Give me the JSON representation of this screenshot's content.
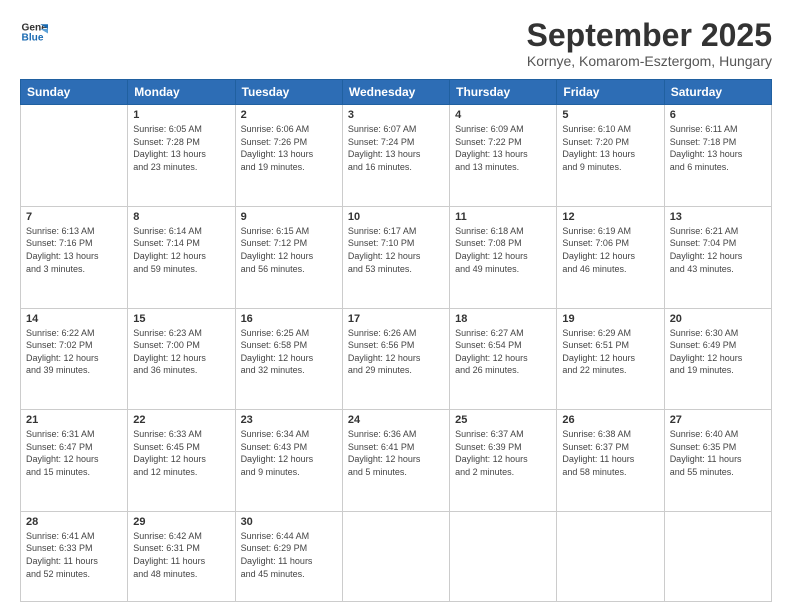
{
  "header": {
    "logo_line1": "General",
    "logo_line2": "Blue",
    "month_title": "September 2025",
    "location": "Kornye, Komarom-Esztergom, Hungary"
  },
  "days_of_week": [
    "Sunday",
    "Monday",
    "Tuesday",
    "Wednesday",
    "Thursday",
    "Friday",
    "Saturday"
  ],
  "weeks": [
    [
      {
        "day": "",
        "content": ""
      },
      {
        "day": "1",
        "content": "Sunrise: 6:05 AM\nSunset: 7:28 PM\nDaylight: 13 hours\nand 23 minutes."
      },
      {
        "day": "2",
        "content": "Sunrise: 6:06 AM\nSunset: 7:26 PM\nDaylight: 13 hours\nand 19 minutes."
      },
      {
        "day": "3",
        "content": "Sunrise: 6:07 AM\nSunset: 7:24 PM\nDaylight: 13 hours\nand 16 minutes."
      },
      {
        "day": "4",
        "content": "Sunrise: 6:09 AM\nSunset: 7:22 PM\nDaylight: 13 hours\nand 13 minutes."
      },
      {
        "day": "5",
        "content": "Sunrise: 6:10 AM\nSunset: 7:20 PM\nDaylight: 13 hours\nand 9 minutes."
      },
      {
        "day": "6",
        "content": "Sunrise: 6:11 AM\nSunset: 7:18 PM\nDaylight: 13 hours\nand 6 minutes."
      }
    ],
    [
      {
        "day": "7",
        "content": "Sunrise: 6:13 AM\nSunset: 7:16 PM\nDaylight: 13 hours\nand 3 minutes."
      },
      {
        "day": "8",
        "content": "Sunrise: 6:14 AM\nSunset: 7:14 PM\nDaylight: 12 hours\nand 59 minutes."
      },
      {
        "day": "9",
        "content": "Sunrise: 6:15 AM\nSunset: 7:12 PM\nDaylight: 12 hours\nand 56 minutes."
      },
      {
        "day": "10",
        "content": "Sunrise: 6:17 AM\nSunset: 7:10 PM\nDaylight: 12 hours\nand 53 minutes."
      },
      {
        "day": "11",
        "content": "Sunrise: 6:18 AM\nSunset: 7:08 PM\nDaylight: 12 hours\nand 49 minutes."
      },
      {
        "day": "12",
        "content": "Sunrise: 6:19 AM\nSunset: 7:06 PM\nDaylight: 12 hours\nand 46 minutes."
      },
      {
        "day": "13",
        "content": "Sunrise: 6:21 AM\nSunset: 7:04 PM\nDaylight: 12 hours\nand 43 minutes."
      }
    ],
    [
      {
        "day": "14",
        "content": "Sunrise: 6:22 AM\nSunset: 7:02 PM\nDaylight: 12 hours\nand 39 minutes."
      },
      {
        "day": "15",
        "content": "Sunrise: 6:23 AM\nSunset: 7:00 PM\nDaylight: 12 hours\nand 36 minutes."
      },
      {
        "day": "16",
        "content": "Sunrise: 6:25 AM\nSunset: 6:58 PM\nDaylight: 12 hours\nand 32 minutes."
      },
      {
        "day": "17",
        "content": "Sunrise: 6:26 AM\nSunset: 6:56 PM\nDaylight: 12 hours\nand 29 minutes."
      },
      {
        "day": "18",
        "content": "Sunrise: 6:27 AM\nSunset: 6:54 PM\nDaylight: 12 hours\nand 26 minutes."
      },
      {
        "day": "19",
        "content": "Sunrise: 6:29 AM\nSunset: 6:51 PM\nDaylight: 12 hours\nand 22 minutes."
      },
      {
        "day": "20",
        "content": "Sunrise: 6:30 AM\nSunset: 6:49 PM\nDaylight: 12 hours\nand 19 minutes."
      }
    ],
    [
      {
        "day": "21",
        "content": "Sunrise: 6:31 AM\nSunset: 6:47 PM\nDaylight: 12 hours\nand 15 minutes."
      },
      {
        "day": "22",
        "content": "Sunrise: 6:33 AM\nSunset: 6:45 PM\nDaylight: 12 hours\nand 12 minutes."
      },
      {
        "day": "23",
        "content": "Sunrise: 6:34 AM\nSunset: 6:43 PM\nDaylight: 12 hours\nand 9 minutes."
      },
      {
        "day": "24",
        "content": "Sunrise: 6:36 AM\nSunset: 6:41 PM\nDaylight: 12 hours\nand 5 minutes."
      },
      {
        "day": "25",
        "content": "Sunrise: 6:37 AM\nSunset: 6:39 PM\nDaylight: 12 hours\nand 2 minutes."
      },
      {
        "day": "26",
        "content": "Sunrise: 6:38 AM\nSunset: 6:37 PM\nDaylight: 11 hours\nand 58 minutes."
      },
      {
        "day": "27",
        "content": "Sunrise: 6:40 AM\nSunset: 6:35 PM\nDaylight: 11 hours\nand 55 minutes."
      }
    ],
    [
      {
        "day": "28",
        "content": "Sunrise: 6:41 AM\nSunset: 6:33 PM\nDaylight: 11 hours\nand 52 minutes."
      },
      {
        "day": "29",
        "content": "Sunrise: 6:42 AM\nSunset: 6:31 PM\nDaylight: 11 hours\nand 48 minutes."
      },
      {
        "day": "30",
        "content": "Sunrise: 6:44 AM\nSunset: 6:29 PM\nDaylight: 11 hours\nand 45 minutes."
      },
      {
        "day": "",
        "content": ""
      },
      {
        "day": "",
        "content": ""
      },
      {
        "day": "",
        "content": ""
      },
      {
        "day": "",
        "content": ""
      }
    ]
  ]
}
